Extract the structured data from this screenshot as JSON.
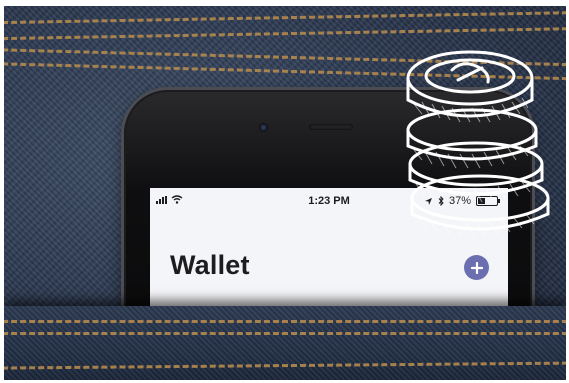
{
  "status_bar": {
    "time": "1:23 PM",
    "battery": "37%",
    "icons": [
      "signal-icon",
      "wifi-icon",
      "location-icon",
      "bluetooth-icon",
      "battery-icon"
    ]
  },
  "wallet": {
    "title": "Wallet",
    "add_icon": "plus-icon"
  },
  "illustration": "coin-stack-icon",
  "colors": {
    "denim": "#2b3850",
    "stitching": "#b48a4e",
    "add_button": "#6b6fb0",
    "screen_bg": "#f4f5f8"
  }
}
